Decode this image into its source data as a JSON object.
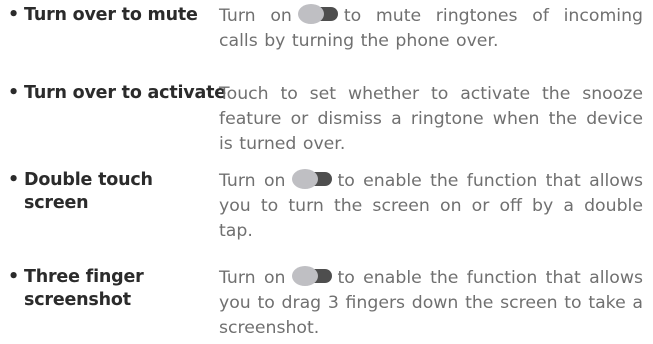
{
  "items": [
    {
      "term": "Turn over to mute",
      "desc_before": "Turn on",
      "desc_after": "to mute ringtones of incoming calls by turning the phone over.",
      "toggle_icon": "toggle-switch-icon"
    },
    {
      "term": "Turn over to activate",
      "desc": "Touch to set whether to activate the snooze feature or dismiss a ringtone when the device is turned over."
    },
    {
      "term": "Double touch screen",
      "desc_before": "Turn on",
      "desc_after": "to enable the function that allows you to turn the screen on or off by a double tap.",
      "toggle_icon": "toggle-switch-icon"
    },
    {
      "term": "Three finger screenshot",
      "desc_before": "Turn on",
      "desc_after": "to enable the function that allows you to drag 3 fingers down the screen to take a screenshot.",
      "toggle_icon": "toggle-switch-icon"
    }
  ],
  "colors": {
    "term": "#2b2b2b",
    "description": "#707070",
    "toggle_track": "#4e4e4e",
    "toggle_knob": "#bfbfc3"
  }
}
